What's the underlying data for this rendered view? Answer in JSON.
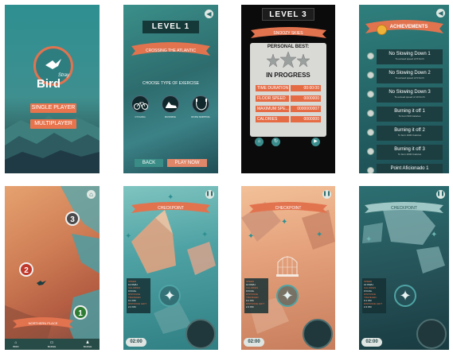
{
  "screen1": {
    "logo_small": "Stray",
    "logo_big": "Bird",
    "single_player_label": "SINGLE PLAYER",
    "multiplayer_label": "MULTIPLAYER"
  },
  "screen2": {
    "title": "LEVEL 1",
    "ribbon_text": "CROSSING THE ATLANTIC",
    "prompt": "CHOOSE TYPE OF EXERCISE",
    "exercises": [
      "CYCLING",
      "RUNNING",
      "ROPE SKIPPING"
    ],
    "back_label": "BACK",
    "play_label": "PLAY NOW"
  },
  "screen3": {
    "title": "LEVEL 3",
    "ribbon_text": "SNOOZY SKIES",
    "personal_best_label": "PERSONAL BEST:",
    "status": "IN PROGRESS",
    "stats": [
      {
        "label": "TIME DURATION",
        "value": "00:00:00"
      },
      {
        "label": "FLOOR SPEED",
        "value": "0000000"
      },
      {
        "label": "MAXIMUM SPE...",
        "value": "0000000007"
      },
      {
        "label": "CALORIES",
        "value": "0000000"
      }
    ]
  },
  "screen4": {
    "ribbon_text": "ACHIEVEMENTS",
    "achievements": [
      {
        "title": "No Slowing Down 1",
        "desc": "To exceed speed of 8 Km/h"
      },
      {
        "title": "No Slowing Down 2",
        "desc": "To exceed speed of 9 Km/h"
      },
      {
        "title": "No Slowing Down 3",
        "desc": "To exceed speed of 10 Km/h"
      },
      {
        "title": "Burning it off 1",
        "desc": "To burn 500 Calories"
      },
      {
        "title": "Burning it off 2",
        "desc": "To burn 1000 Calories"
      },
      {
        "title": "Burning it off 3",
        "desc": "To burn 2000 Calories"
      },
      {
        "title": "Point Aficionado 1",
        "desc": ""
      }
    ]
  },
  "screen5": {
    "pins": [
      "3",
      "2",
      "1"
    ],
    "ribbon_text": "NORTHERN PLACE",
    "tabs": [
      "BIRD",
      "BADGE",
      "BADGE"
    ]
  },
  "checkpoint": {
    "ribbon_text": "CHECKPOINT",
    "stats": [
      {
        "label": "SPEED",
        "value": "12 KM/H"
      },
      {
        "label": "CALORIES",
        "value": "0 KCAL"
      },
      {
        "label": "DISTANCE TRAVELED",
        "value": "0.1 KM"
      },
      {
        "label": "DISTANCE LEFT",
        "value": "2.4 KM"
      }
    ],
    "timer": "02:00"
  },
  "colors": {
    "accent_orange": "#e8744d",
    "teal": "#2e8f91",
    "dark_teal": "#153839"
  }
}
